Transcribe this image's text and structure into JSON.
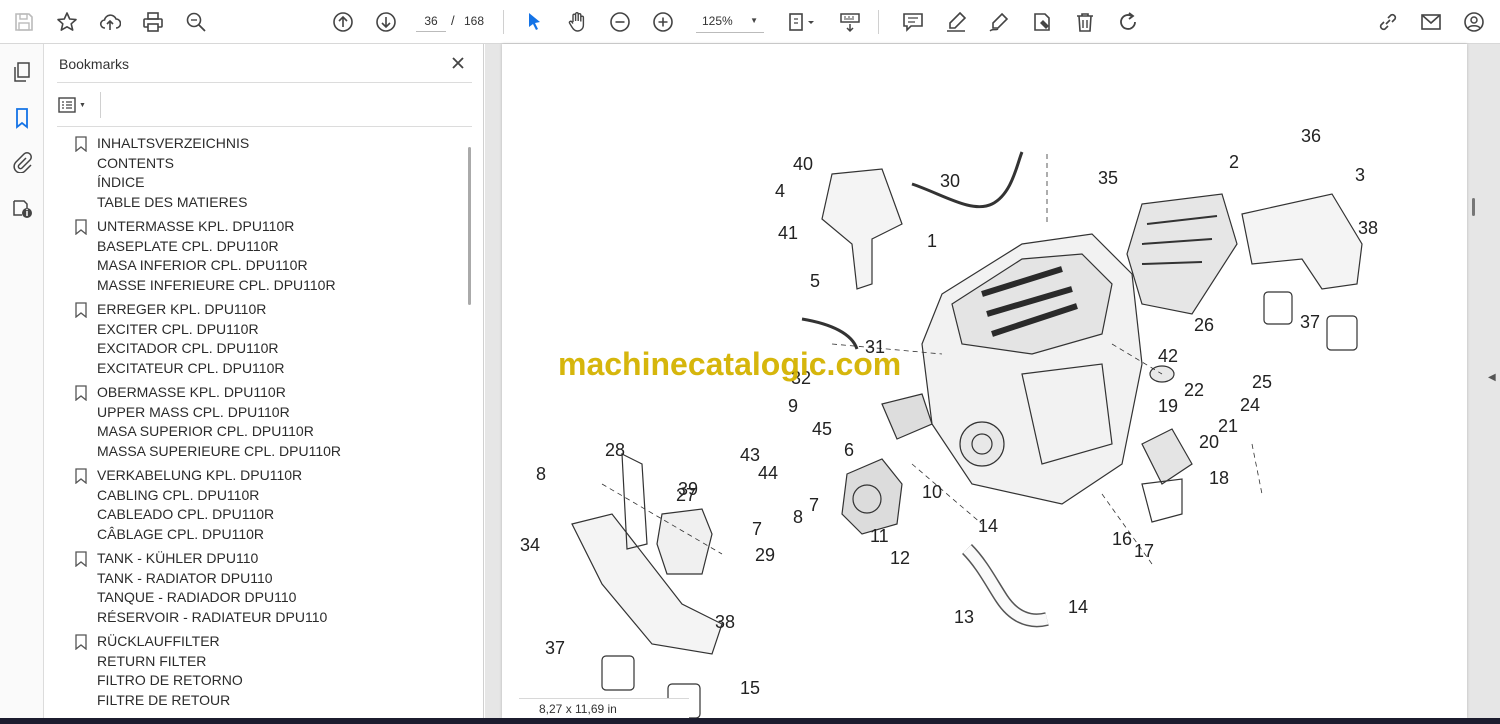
{
  "toolbar": {
    "page_current": "36",
    "page_separator": "/",
    "page_total": "168",
    "zoom": "125%",
    "icons": [
      "save-icon",
      "bookmark-star-icon",
      "upload-cloud-icon",
      "print-icon",
      "zoom-search-icon",
      "page-up-icon",
      "page-down-icon",
      "select-cursor-icon",
      "hand-icon",
      "zoom-out-icon",
      "zoom-in-icon",
      "fit-page-icon",
      "scroll-mode-icon",
      "comment-icon",
      "highlight-pen-icon",
      "sign-icon",
      "stamp-icon",
      "delete-icon",
      "rotate-icon",
      "share-link-icon",
      "email-icon",
      "account-icon"
    ]
  },
  "colors": {
    "accent": "#1473e6",
    "watermark": "#d4b300",
    "bottom_bar": "#1c1c2e"
  },
  "panel": {
    "title": "Bookmarks",
    "bookmarks": [
      {
        "lines": [
          "INHALTSVERZEICHNIS",
          "CONTENTS",
          "ÍNDICE",
          "TABLE DES MATIERES"
        ]
      },
      {
        "lines": [
          "UNTERMASSE KPL. DPU110R",
          "BASEPLATE CPL. DPU110R",
          "MASA INFERIOR CPL. DPU110R",
          "MASSE INFERIEURE CPL. DPU110R"
        ]
      },
      {
        "lines": [
          "ERREGER KPL. DPU110R",
          "EXCITER CPL. DPU110R",
          "EXCITADOR CPL. DPU110R",
          "EXCITATEUR CPL. DPU110R"
        ]
      },
      {
        "lines": [
          "OBERMASSE KPL. DPU110R",
          "UPPER MASS CPL. DPU110R",
          "MASA SUPERIOR CPL. DPU110R",
          "MASSA SUPERIEURE CPL. DPU110R"
        ]
      },
      {
        "lines": [
          "VERKABELUNG KPL. DPU110R",
          "CABLING CPL. DPU110R",
          "CABLEADO CPL. DPU110R",
          "CÂBLAGE CPL. DPU110R"
        ]
      },
      {
        "lines": [
          "TANK - KÜHLER DPU110",
          "TANK - RADIATOR DPU110",
          "TANQUE - RADIADOR DPU110",
          "RÉSERVOIR - RADIATEUR DPU110"
        ]
      },
      {
        "lines": [
          "RÜCKLAUFFILTER",
          "RETURN FILTER",
          "FILTRO DE RETORNO",
          "FILTRE DE RETOUR"
        ]
      }
    ]
  },
  "document": {
    "watermark": "machinecatalogic.com",
    "page_size": "8,27 x 11,69 in",
    "part_labels": [
      "1",
      "2",
      "3",
      "4",
      "5",
      "6",
      "7",
      "7",
      "8",
      "8",
      "9",
      "10",
      "11",
      "12",
      "13",
      "14",
      "14",
      "15",
      "16",
      "17",
      "18",
      "19",
      "20",
      "21",
      "22",
      "24",
      "25",
      "26",
      "27",
      "28",
      "29",
      "30",
      "31",
      "32",
      "34",
      "35",
      "36",
      "37",
      "37",
      "38",
      "38",
      "39",
      "40",
      "41",
      "42",
      "43",
      "44",
      "45"
    ]
  }
}
